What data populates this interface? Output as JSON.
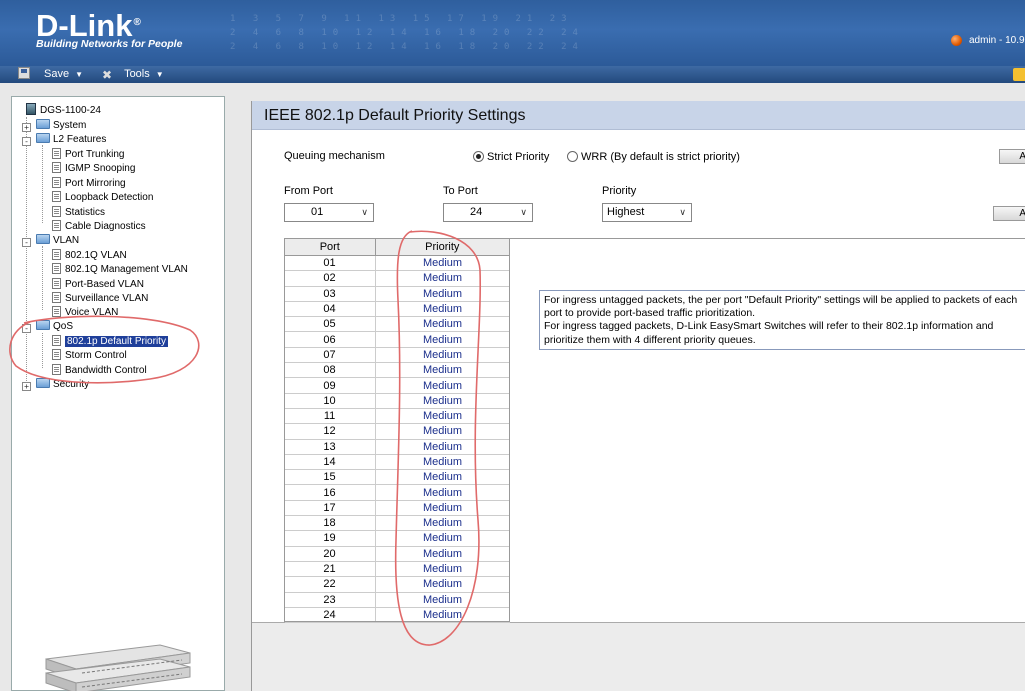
{
  "header": {
    "logo_text": "D-Link",
    "logo_reg": "®",
    "tagline": "Building Networks for People",
    "user_text": "admin - 10.9",
    "pattern_rows": [
      "1 3 5 7 9 11 13 15 17 19 21 23",
      "2 4 6 8 10 12 14 16 18 20 22 24",
      "2 4 6 8 10 12 14 16 18 20 22 24"
    ]
  },
  "menubar": {
    "save_label": "Save",
    "tools_label": "Tools"
  },
  "tree": {
    "root": "DGS-1100-24",
    "system": "System",
    "l2_features": "L2 Features",
    "l2_items": [
      "Port Trunking",
      "IGMP Snooping",
      "Port Mirroring",
      "Loopback Detection",
      "Statistics",
      "Cable Diagnostics"
    ],
    "vlan": "VLAN",
    "vlan_items": [
      "802.1Q VLAN",
      "802.1Q Management VLAN",
      "Port-Based VLAN",
      "Surveillance VLAN",
      "Voice VLAN"
    ],
    "qos": "QoS",
    "qos_items": [
      "802.1p Default Priority",
      "Storm Control",
      "Bandwidth Control"
    ],
    "security": "Security"
  },
  "page": {
    "title": "IEEE 802.1p Default Priority Settings",
    "queuing_label": "Queuing mechanism",
    "strict_label": "Strict Priority",
    "wrr_label": "WRR (By default is strict priority)",
    "queuing_selected": "Strict Priority",
    "apply_btn_1": "A",
    "apply_btn_2": "A",
    "from_port_label": "From Port",
    "from_port_value": "01",
    "to_port_label": "To Port",
    "to_port_value": "24",
    "priority_label": "Priority",
    "priority_value": "Highest",
    "table_headers": [
      "Port",
      "Priority"
    ],
    "ports": [
      {
        "port": "01",
        "priority": "Medium"
      },
      {
        "port": "02",
        "priority": "Medium"
      },
      {
        "port": "03",
        "priority": "Medium"
      },
      {
        "port": "04",
        "priority": "Medium"
      },
      {
        "port": "05",
        "priority": "Medium"
      },
      {
        "port": "06",
        "priority": "Medium"
      },
      {
        "port": "07",
        "priority": "Medium"
      },
      {
        "port": "08",
        "priority": "Medium"
      },
      {
        "port": "09",
        "priority": "Medium"
      },
      {
        "port": "10",
        "priority": "Medium"
      },
      {
        "port": "11",
        "priority": "Medium"
      },
      {
        "port": "12",
        "priority": "Medium"
      },
      {
        "port": "13",
        "priority": "Medium"
      },
      {
        "port": "14",
        "priority": "Medium"
      },
      {
        "port": "15",
        "priority": "Medium"
      },
      {
        "port": "16",
        "priority": "Medium"
      },
      {
        "port": "17",
        "priority": "Medium"
      },
      {
        "port": "18",
        "priority": "Medium"
      },
      {
        "port": "19",
        "priority": "Medium"
      },
      {
        "port": "20",
        "priority": "Medium"
      },
      {
        "port": "21",
        "priority": "Medium"
      },
      {
        "port": "22",
        "priority": "Medium"
      },
      {
        "port": "23",
        "priority": "Medium"
      },
      {
        "port": "24",
        "priority": "Medium"
      }
    ],
    "info_line1": "For ingress untagged packets, the per port \"Default Priority\" settings will be applied to packets of each port to provide port-based traffic prioritization.",
    "info_line2": "For ingress tagged packets, D-Link EasySmart Switches will refer to their 802.1p information and prioritize them with 4 different priority queues."
  },
  "colors": {
    "header_blue": "#2f5f9e",
    "selected_bg": "#1f3f9a",
    "priority_text": "#1b2f8c",
    "annotation_red": "#e06a6a"
  }
}
